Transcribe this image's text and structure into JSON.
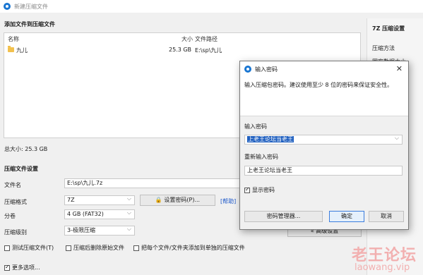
{
  "window": {
    "title": "新建压缩文件"
  },
  "add_files": {
    "section_title": "添加文件到压缩文件",
    "columns": {
      "name": "名称",
      "size": "大小",
      "path": "文件路径"
    },
    "rows": [
      {
        "name": "九儿",
        "size": "25.3 GB",
        "path": "E:\\sp\\九儿"
      }
    ],
    "total": "总大小: 25.3 GB"
  },
  "settings": {
    "section_title": "压缩文件设置",
    "filename_label": "文件名",
    "filename_value": "E:\\sp\\九儿.7z",
    "format_label": "压缩格式",
    "format_value": "7Z",
    "split_label": "分卷",
    "split_value": "4 GB (FAT32)",
    "level_label": "压缩级别",
    "level_value": "3-极限压缩",
    "set_password_btn": "设置密码(P)...",
    "help_link": "[帮助]",
    "advanced_btn": "« 高级设置",
    "test_check": "测试压缩文件(T)",
    "delete_check": "压缩后删除原始文件",
    "separate_check": "把每个文件/文件夹添加到单独的压缩文件",
    "more_options": "更多选项..."
  },
  "side": {
    "title": "7Z 压缩设置",
    "method": "压缩方法",
    "dict": "固实数据大小"
  },
  "dialog": {
    "title": "输入密码",
    "hint": "输入压缩包密码。建议使用至少 8 位的密码来保证安全性。",
    "pwd_label": "输入密码",
    "pwd_value": "上老王论坛当老王",
    "repeat_label": "重新输入密码",
    "repeat_value": "上老王论坛当老王",
    "show_pwd": "显示密码",
    "manager_btn": "密码管理器...",
    "ok_btn": "确定",
    "cancel_btn": "取消",
    "close_icon": "close-icon"
  },
  "watermark": {
    "cn": "老王论坛",
    "en": "laowang.vip"
  },
  "colors": {
    "accent": "#1976d2",
    "selection": "#1f5fbf",
    "link": "#1a56c9"
  }
}
